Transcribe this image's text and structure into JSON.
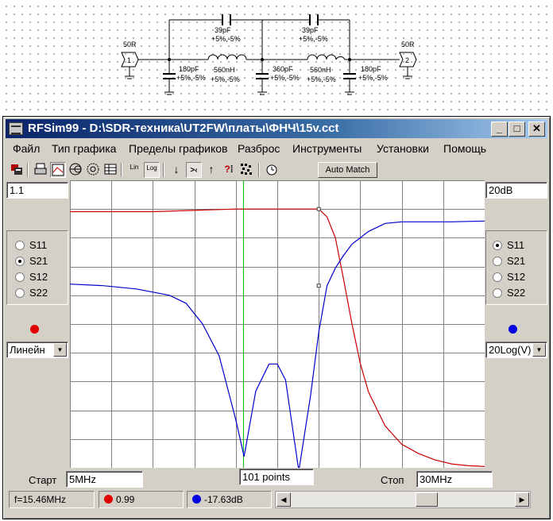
{
  "schematic": {
    "port1": {
      "label": "50R",
      "number": "1"
    },
    "port2": {
      "label": "50R",
      "number": "2"
    },
    "components": [
      {
        "id": "c-series-1",
        "value": "39pF",
        "tolerance": "+5%,-5%"
      },
      {
        "id": "c-series-2",
        "value": "39pF",
        "tolerance": "+5%,-5%"
      },
      {
        "id": "c-shunt-1",
        "value": "180pF",
        "tolerance": "+5%,-5%"
      },
      {
        "id": "l-1",
        "value": "560nH",
        "tolerance": "+5%,-5%"
      },
      {
        "id": "c-shunt-2",
        "value": "360pF",
        "tolerance": "+5%,-5%"
      },
      {
        "id": "l-2",
        "value": "560nH",
        "tolerance": "+5%,-5%"
      },
      {
        "id": "c-shunt-3",
        "value": "180pF",
        "tolerance": "+5%,-5%"
      }
    ]
  },
  "window": {
    "title": "RFSim99 - D:\\SDR-техника\\UT2FW\\платы\\ФНЧ\\15v.cct",
    "buttons": {
      "minimize": "_",
      "maximize": "□",
      "close": "✕"
    }
  },
  "menu": [
    "Файл",
    "Тип графика",
    "Пределы графиков",
    "Разброс",
    "Инструменты",
    "Установки",
    "Помощь"
  ],
  "toolbar": {
    "icons": [
      "schematic-icon",
      "print-icon",
      "rect-plot-icon",
      "smith-chart-icon",
      "polar-chart-icon",
      "table-icon",
      "lin-scale-icon",
      "log-scale-icon",
      "arrow-down-icon",
      "narrow-icon",
      "arrow-up-icon",
      "query-icon",
      "random-icon",
      "timer-icon"
    ],
    "lin_label": "Lin",
    "log_label": "Log",
    "auto_match": "Auto Match"
  },
  "left": {
    "scale_value": "1.1",
    "params": [
      "S11",
      "S21",
      "S12",
      "S22"
    ],
    "selected": "S21",
    "color": "#e00000",
    "scale_mode": "Линейн"
  },
  "right": {
    "scale_value": "20dB",
    "params": [
      "S11",
      "S21",
      "S12",
      "S22"
    ],
    "selected": "S11",
    "color": "#0000e0",
    "scale_mode": "20Log(V)"
  },
  "sweep": {
    "start_label": "Старт",
    "start_value": "5MHz",
    "points": "101 points",
    "stop_label": "Стоп",
    "stop_value": "30MHz"
  },
  "cursor": {
    "frequency_mhz": 15.46,
    "readout_frequency": "f=15.46MHz",
    "readout_left": "0.99",
    "readout_right": "-17.63dB"
  },
  "chart_data": {
    "type": "line",
    "x_range": [
      5,
      30
    ],
    "x_unit": "MHz",
    "left_axis": {
      "range": [
        0,
        1.1
      ],
      "scale": "linear"
    },
    "right_axis": {
      "range": [
        -160,
        20
      ],
      "scale": "20Log(V)"
    },
    "grid": true,
    "series": [
      {
        "axis": "left",
        "color": "#cc0000",
        "x": [
          5,
          10,
          15,
          19,
          20,
          20.5,
          21,
          21.5,
          22,
          22.5,
          23,
          24,
          25,
          26,
          27,
          28,
          29,
          30
        ],
        "values": [
          0.98,
          0.98,
          0.99,
          0.99,
          0.99,
          0.96,
          0.88,
          0.72,
          0.55,
          0.4,
          0.29,
          0.16,
          0.09,
          0.055,
          0.03,
          0.015,
          0.008,
          0.005
        ]
      },
      {
        "axis": "right",
        "color": "#0000cc",
        "x": [
          5,
          7,
          9,
          11,
          12,
          13,
          14,
          15,
          15.5,
          16.2,
          17.0,
          17.5,
          18.0,
          18.8,
          19.5,
          20,
          20.5,
          21,
          21.5,
          22,
          23,
          24,
          25,
          26,
          28,
          30
        ],
        "values": [
          -45,
          -46,
          -48,
          -52,
          -57,
          -70,
          -90,
          -130,
          -153,
          -112,
          -95,
          -95,
          -105,
          -162,
          -115,
          -75,
          -46,
          -35,
          -27,
          -20,
          -12,
          -7,
          -6,
          -6,
          -6,
          -5.5
        ]
      }
    ]
  }
}
